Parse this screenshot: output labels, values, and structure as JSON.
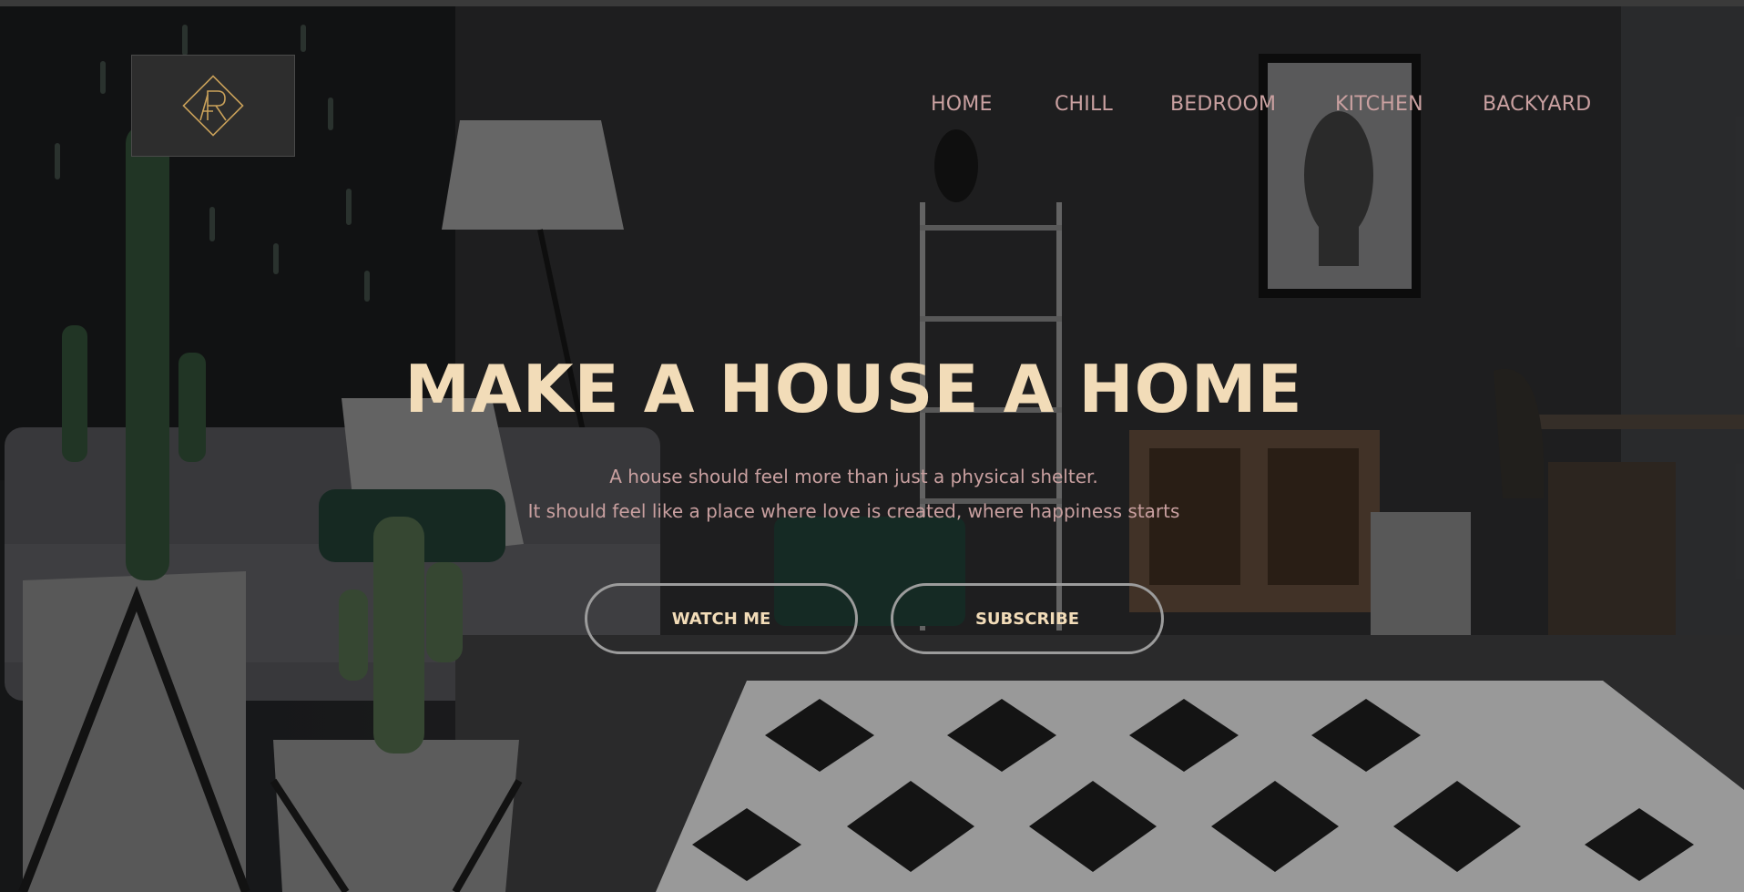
{
  "nav": {
    "items": [
      {
        "label": "HOME"
      },
      {
        "label": "CHILL"
      },
      {
        "label": "BEDROOM"
      },
      {
        "label": "KITCHEN"
      },
      {
        "label": "BACKYARD"
      }
    ]
  },
  "logo": {
    "icon": "diamond-monogram-logo",
    "color": "#c9a15a"
  },
  "hero": {
    "title": "MAKE A HOUSE A HOME",
    "subtitle_line1": "A house should feel more than just a physical shelter.",
    "subtitle_line2": "It should feel like a place where love is created, where happiness starts",
    "buttons": {
      "watch_label": "WATCH ME",
      "subscribe_label": "SUBSCRIBE"
    }
  },
  "colors": {
    "title": "#f2dcb8",
    "nav_text": "#c9a0a0",
    "button_border": "#9c9c9c"
  }
}
